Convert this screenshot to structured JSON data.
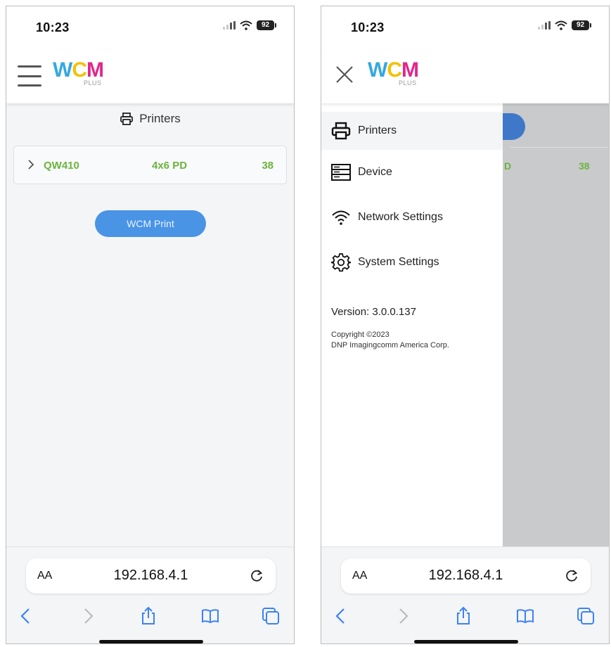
{
  "colors": {
    "accent_green": "#6cb33f",
    "button_blue": "#4a94e6",
    "logo_w": "#33a9e0",
    "logo_c": "#f2c200",
    "logo_m": "#e0288c",
    "overlay_gray": "#c9cacc"
  },
  "status_bar": {
    "time": "10:23",
    "battery": "92",
    "signal_icon": "cellular-signal-icon",
    "wifi_icon": "wifi-icon"
  },
  "logo": {
    "letters": [
      "W",
      "C",
      "M"
    ],
    "subtitle": "PLUS"
  },
  "left": {
    "page_title": "Printers",
    "page_title_icon": "printer-icon",
    "printer": {
      "name": "QW410",
      "media": "4x6 PD",
      "count": "38"
    },
    "print_button": "WCM Print"
  },
  "right": {
    "overlay": {
      "media_partial": "D",
      "count": "38"
    },
    "menu": [
      {
        "label": "Printers",
        "icon": "printer-icon",
        "active": true
      },
      {
        "label": "Device",
        "icon": "server-icon",
        "active": false
      },
      {
        "label": "Network Settings",
        "icon": "wifi-icon",
        "active": false
      },
      {
        "label": "System Settings",
        "icon": "gear-icon",
        "active": false
      }
    ],
    "version": "Version: 3.0.0.137",
    "copyright_line1": "Copyright ©2023",
    "copyright_line2": "DNP Imagingcomm America Corp."
  },
  "browser": {
    "text_size": "AA",
    "url": "192.168.4.1",
    "toolbar_icons": [
      "back-icon",
      "forward-icon",
      "share-icon",
      "bookmarks-icon",
      "tabs-icon"
    ]
  }
}
